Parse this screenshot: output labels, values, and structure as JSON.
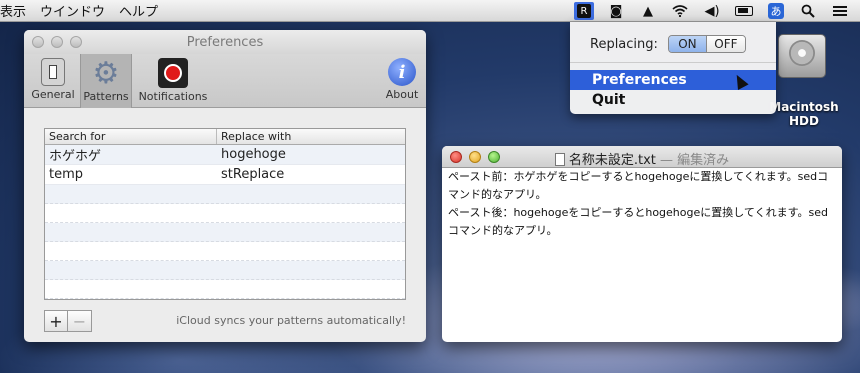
{
  "menubar": {
    "items": [
      "表示",
      "ウインドウ",
      "ヘルプ"
    ],
    "status_icons": [
      "app-icon",
      "camera-icon",
      "hat-icon",
      "wifi-icon",
      "volume-icon",
      "battery-icon",
      "input-method-icon",
      "spotlight-icon",
      "notification-center-icon"
    ],
    "input_method_label": "あ",
    "accent_color": "#2d5fd9"
  },
  "dropdown": {
    "replacing_label": "Replacing:",
    "on_label": "ON",
    "off_label": "OFF",
    "selected": "ON",
    "items": [
      "Preferences",
      "Quit"
    ],
    "highlighted": "Preferences"
  },
  "desktop": {
    "hdd_label_line1": "Macintosh",
    "hdd_label_line2": "HDD"
  },
  "prefs": {
    "title": "Preferences",
    "toolbar": [
      {
        "label": "General",
        "icon": "switch-icon"
      },
      {
        "label": "Patterns",
        "icon": "gear-icon",
        "selected": true
      },
      {
        "label": "Notifications",
        "icon": "record-icon"
      },
      {
        "label": "About",
        "icon": "info-icon"
      }
    ],
    "table": {
      "columns": [
        "Search for",
        "Replace with"
      ],
      "rows": [
        {
          "search": "ホゲホゲ",
          "replace": "hogehoge"
        },
        {
          "search": "temp",
          "replace": "stReplace"
        }
      ]
    },
    "add_label": "+",
    "remove_label": "−",
    "icloud_note": "iCloud syncs your patterns automatically!"
  },
  "textedit": {
    "title": "名称未設定.txt",
    "edited": "— 編集済み",
    "lines": [
      "ペースト前：ホゲホゲをコピーするとhogehogeに置換してくれます。sedコ",
      "マンド的なアプリ。",
      "ペースト後：hogehogeをコピーするとhogehogeに置換してくれます。sed",
      "コマンド的なアプリ。"
    ]
  }
}
